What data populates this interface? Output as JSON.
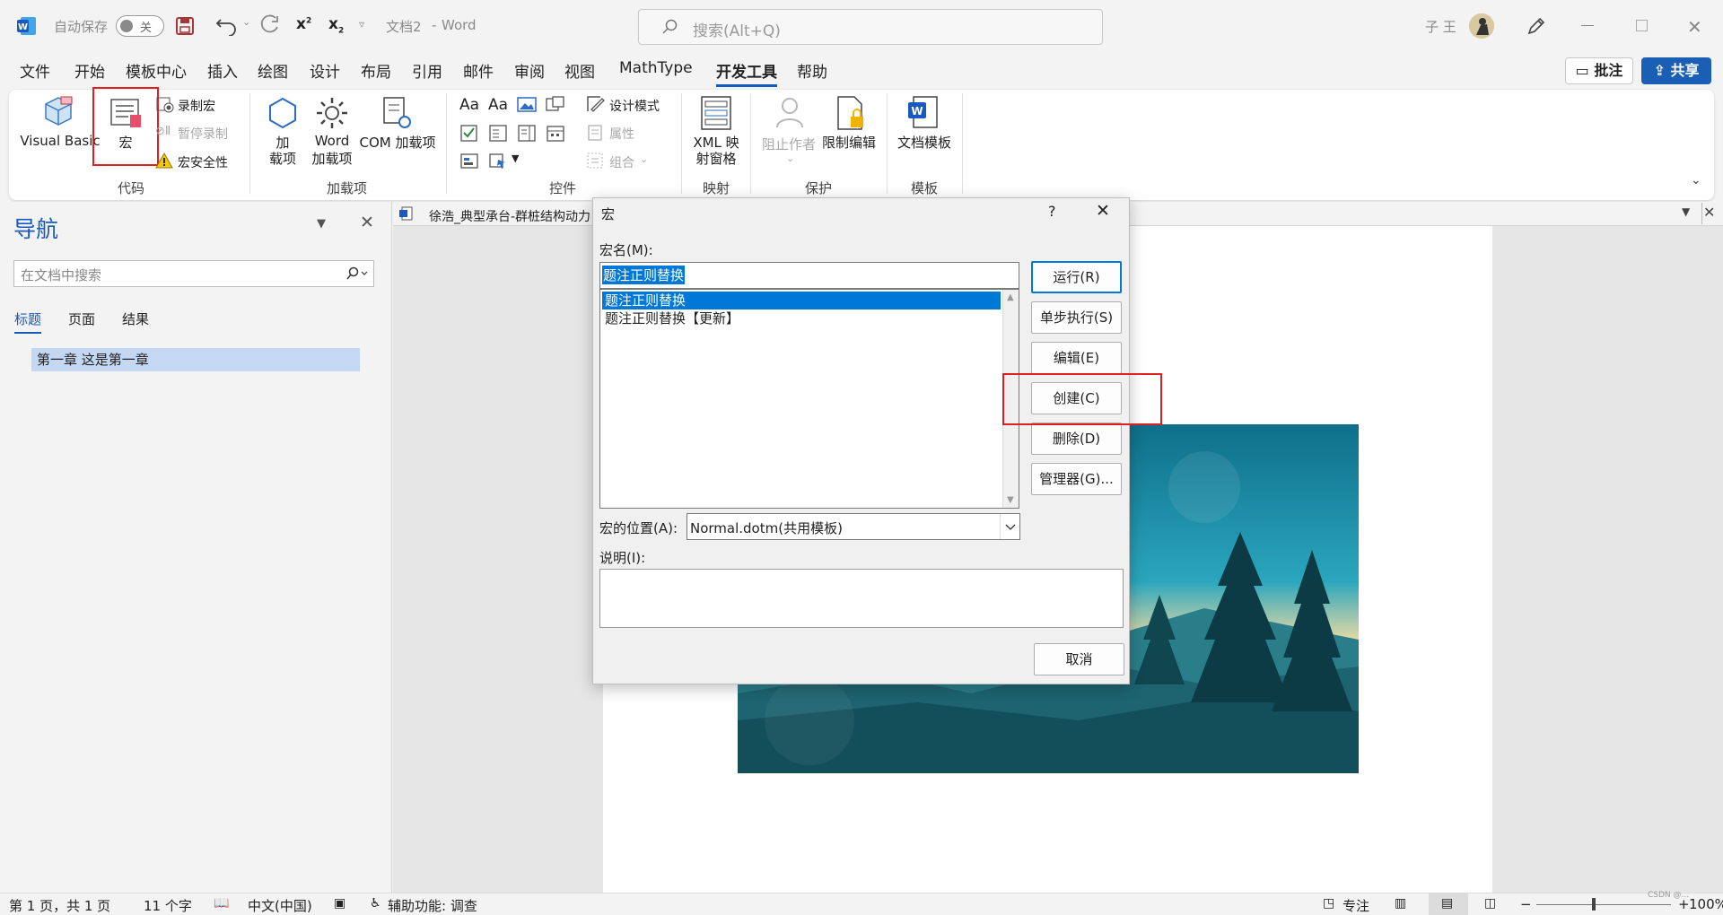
{
  "titlebar": {
    "autosave_label": "自动保存",
    "autosave_state": "关",
    "doc_title": "文档2",
    "app_name": "Word",
    "separator": "-",
    "search_placeholder": "搜索(Alt+Q)",
    "user_name": "子 王"
  },
  "menu": {
    "tabs": [
      "文件",
      "开始",
      "模板中心",
      "插入",
      "绘图",
      "设计",
      "布局",
      "引用",
      "邮件",
      "审阅",
      "视图",
      "MathType",
      "开发工具",
      "帮助"
    ],
    "active_tab": "开发工具",
    "comment_button": "批注",
    "share_button": "共享"
  },
  "ribbon": {
    "code": {
      "label": "代码",
      "visual_basic": "Visual Basic",
      "macros": "宏",
      "record_macro": "录制宏",
      "pause_recording": "暂停录制",
      "macro_security": "宏安全性"
    },
    "addins": {
      "label": "加载项",
      "addins_line1": "加",
      "addins_line2": "载项",
      "word_addins_line1": "Word",
      "word_addins_line2": "加载项",
      "com_addins": "COM 加载项"
    },
    "controls": {
      "label": "控件",
      "design_mode": "设计模式",
      "properties": "属性",
      "group": "组合"
    },
    "mapping": {
      "label": "映射",
      "xml_line1": "XML 映",
      "xml_line2": "射窗格"
    },
    "protect": {
      "label": "保护",
      "block_authors": "阻止作者",
      "restrict_editing": "限制编辑"
    },
    "templates": {
      "label": "模板",
      "document_template": "文档模板"
    }
  },
  "nav_pane": {
    "title": "导航",
    "search_placeholder": "在文档中搜索",
    "tabs": [
      "标题",
      "页面",
      "结果"
    ],
    "active_tab": "标题",
    "headings": [
      "第一章 这是第一章"
    ]
  },
  "document": {
    "tab_title": "徐浩_典型承台-群桩结构动力"
  },
  "macro_dialog": {
    "title": "宏",
    "help": "?",
    "macro_name_label": "宏名(M):",
    "macro_name_value": "题注正则替换",
    "macros": [
      "题注正则替换",
      "题注正则替换【更新】"
    ],
    "selected_index": 0,
    "location_label": "宏的位置(A):",
    "location_value": "Normal.dotm(共用模板)",
    "description_label": "说明(I):",
    "buttons": {
      "run": "运行(R)",
      "step_into": "单步执行(S)",
      "edit": "编辑(E)",
      "create": "创建(C)",
      "delete": "删除(D)",
      "organizer": "管理器(G)...",
      "cancel": "取消"
    }
  },
  "statusbar": {
    "page": "第 1 页，共 1 页",
    "words": "11 个字",
    "language": "中文(中国)",
    "accessibility": "辅助功能: 调查",
    "focus": "专注",
    "zoom": "100%",
    "watermark": "CSDN @..."
  },
  "colors": {
    "accent": "#185abd",
    "share_button": "#1a5fb4",
    "selection": "#0078d7",
    "highlight_box": "#e02020",
    "nav_heading_bg": "#c5d8f3"
  }
}
